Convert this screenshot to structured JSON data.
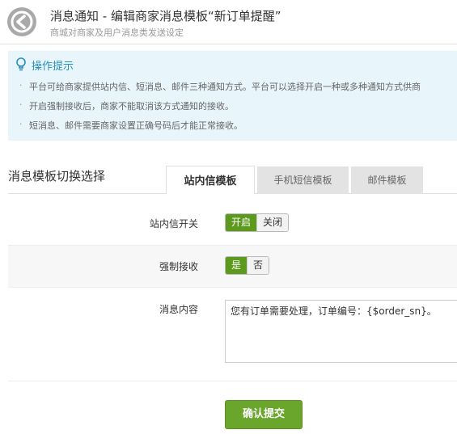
{
  "header": {
    "title": "消息通知 - 编辑商家消息模板“新订单提醒”",
    "subtitle": "商城对商家及用户消息类发送设定",
    "back_icon": "arrow-left-circle-icon"
  },
  "tips": {
    "title": "操作提示",
    "icon": "lightbulb-icon",
    "items": [
      "平台可给商家提供站内信、短消息、邮件三种通知方式。平台可以选择开启一种或多种通知方式供商",
      "开启强制接收后，商家不能取消该方式通知的接收。",
      "短消息、邮件需要商家设置正确号码后才能正常接收。"
    ]
  },
  "section_label": "消息模板切换选择",
  "tabs": [
    {
      "label": "站内信模板",
      "active": true
    },
    {
      "label": "手机短信模板",
      "active": false
    },
    {
      "label": "邮件模板",
      "active": false
    }
  ],
  "form": {
    "switch_label": "站内信开关",
    "switch_on": "开启",
    "switch_off": "关闭",
    "force_label": "强制接收",
    "force_yes": "是",
    "force_no": "否",
    "content_label": "消息内容",
    "content_value": "您有订单需要处理，订单编号：{$order_sn}。"
  },
  "submit_label": "确认提交",
  "colors": {
    "accent_green": "#5c9a1e",
    "tips_bg": "#e8f6fb",
    "tips_title": "#2a8fbd"
  }
}
